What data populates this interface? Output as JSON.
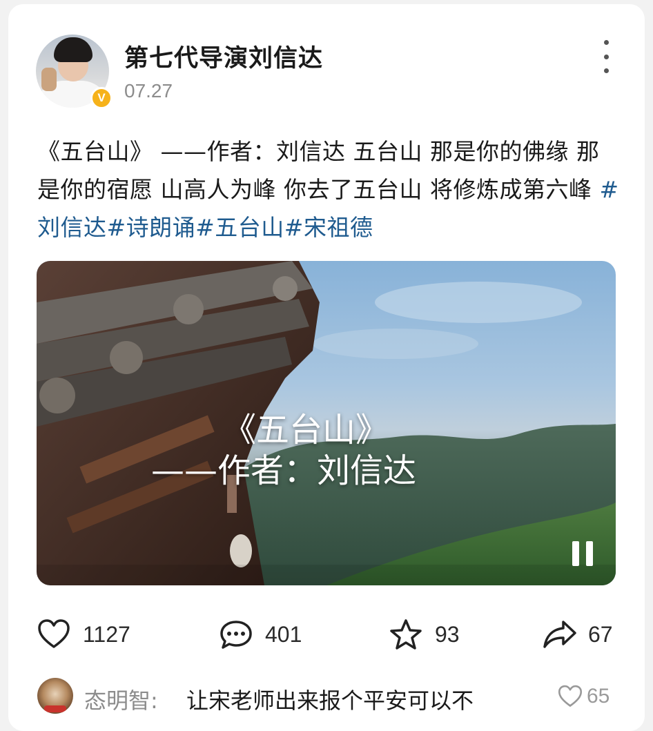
{
  "post": {
    "author": "第七代导演刘信达",
    "date": "07.27",
    "verified_badge": "V",
    "text": "《五台山》 ——作者：刘信达 五台山 那是你的佛缘 那是你的宿愿 山高人为峰 你去了五台山 将修炼成第六峰 ",
    "hashtags": "#刘信达#诗朗诵#五台山#宋祖德"
  },
  "video": {
    "title_line1": "《五台山》",
    "title_line2": "——作者：刘信达",
    "state": "playing"
  },
  "actions": {
    "likes": "1127",
    "comments": "401",
    "favorites": "93",
    "shares": "67"
  },
  "comment": {
    "user": "态明智",
    "separator": ":",
    "text": "让宋老师出来报个平安可以不",
    "likes": "65"
  },
  "icons": {
    "more": "more-vertical-icon",
    "like": "heart-icon",
    "comment": "comment-bubble-icon",
    "favorite": "star-icon",
    "share": "share-arrow-icon",
    "pause": "pause-icon"
  },
  "colors": {
    "hashtag": "#1f5b8f",
    "badge": "#f6b21a",
    "date": "#8c8c8c"
  }
}
